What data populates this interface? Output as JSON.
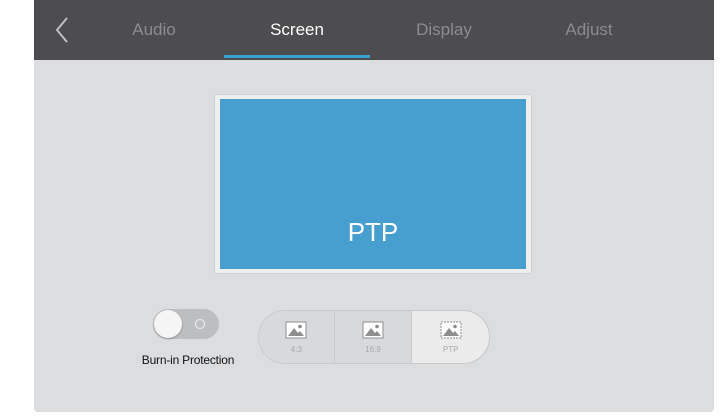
{
  "header": {
    "tabs": [
      {
        "label": "Audio"
      },
      {
        "label": "Screen"
      },
      {
        "label": "Display"
      },
      {
        "label": "Adjust"
      }
    ],
    "active_tab": "Screen"
  },
  "preview": {
    "label": "PTP"
  },
  "burn_in": {
    "label": "Burn-in Protection",
    "enabled": false
  },
  "aspect_ratio": {
    "options": [
      {
        "label": "4:3",
        "icon": "image-icon"
      },
      {
        "label": "16:9",
        "icon": "image-icon"
      },
      {
        "label": "PTP",
        "icon": "image-icon"
      }
    ],
    "selected": "PTP"
  },
  "colors": {
    "topbar": "#4d4d4f",
    "accent": "#3aa0d4",
    "preview": "#479fcf",
    "background": "#dcdddf"
  }
}
